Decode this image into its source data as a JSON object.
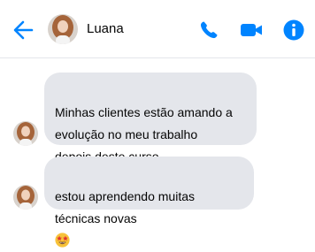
{
  "header": {
    "contact_name": "Luana",
    "accent_color": "#0084ff",
    "icons": [
      "back-arrow-icon",
      "phone-icon",
      "video-camera-icon",
      "info-icon"
    ]
  },
  "messages": [
    {
      "sender": "Luana",
      "text": "Minhas clientes estão amando a\nevolução no meu trabalho\ndepois deste curso"
    },
    {
      "sender": "Luana",
      "text": "estou aprendendo muitas\ntécnicas novas",
      "emoji": "star-struck-emoji"
    }
  ]
}
